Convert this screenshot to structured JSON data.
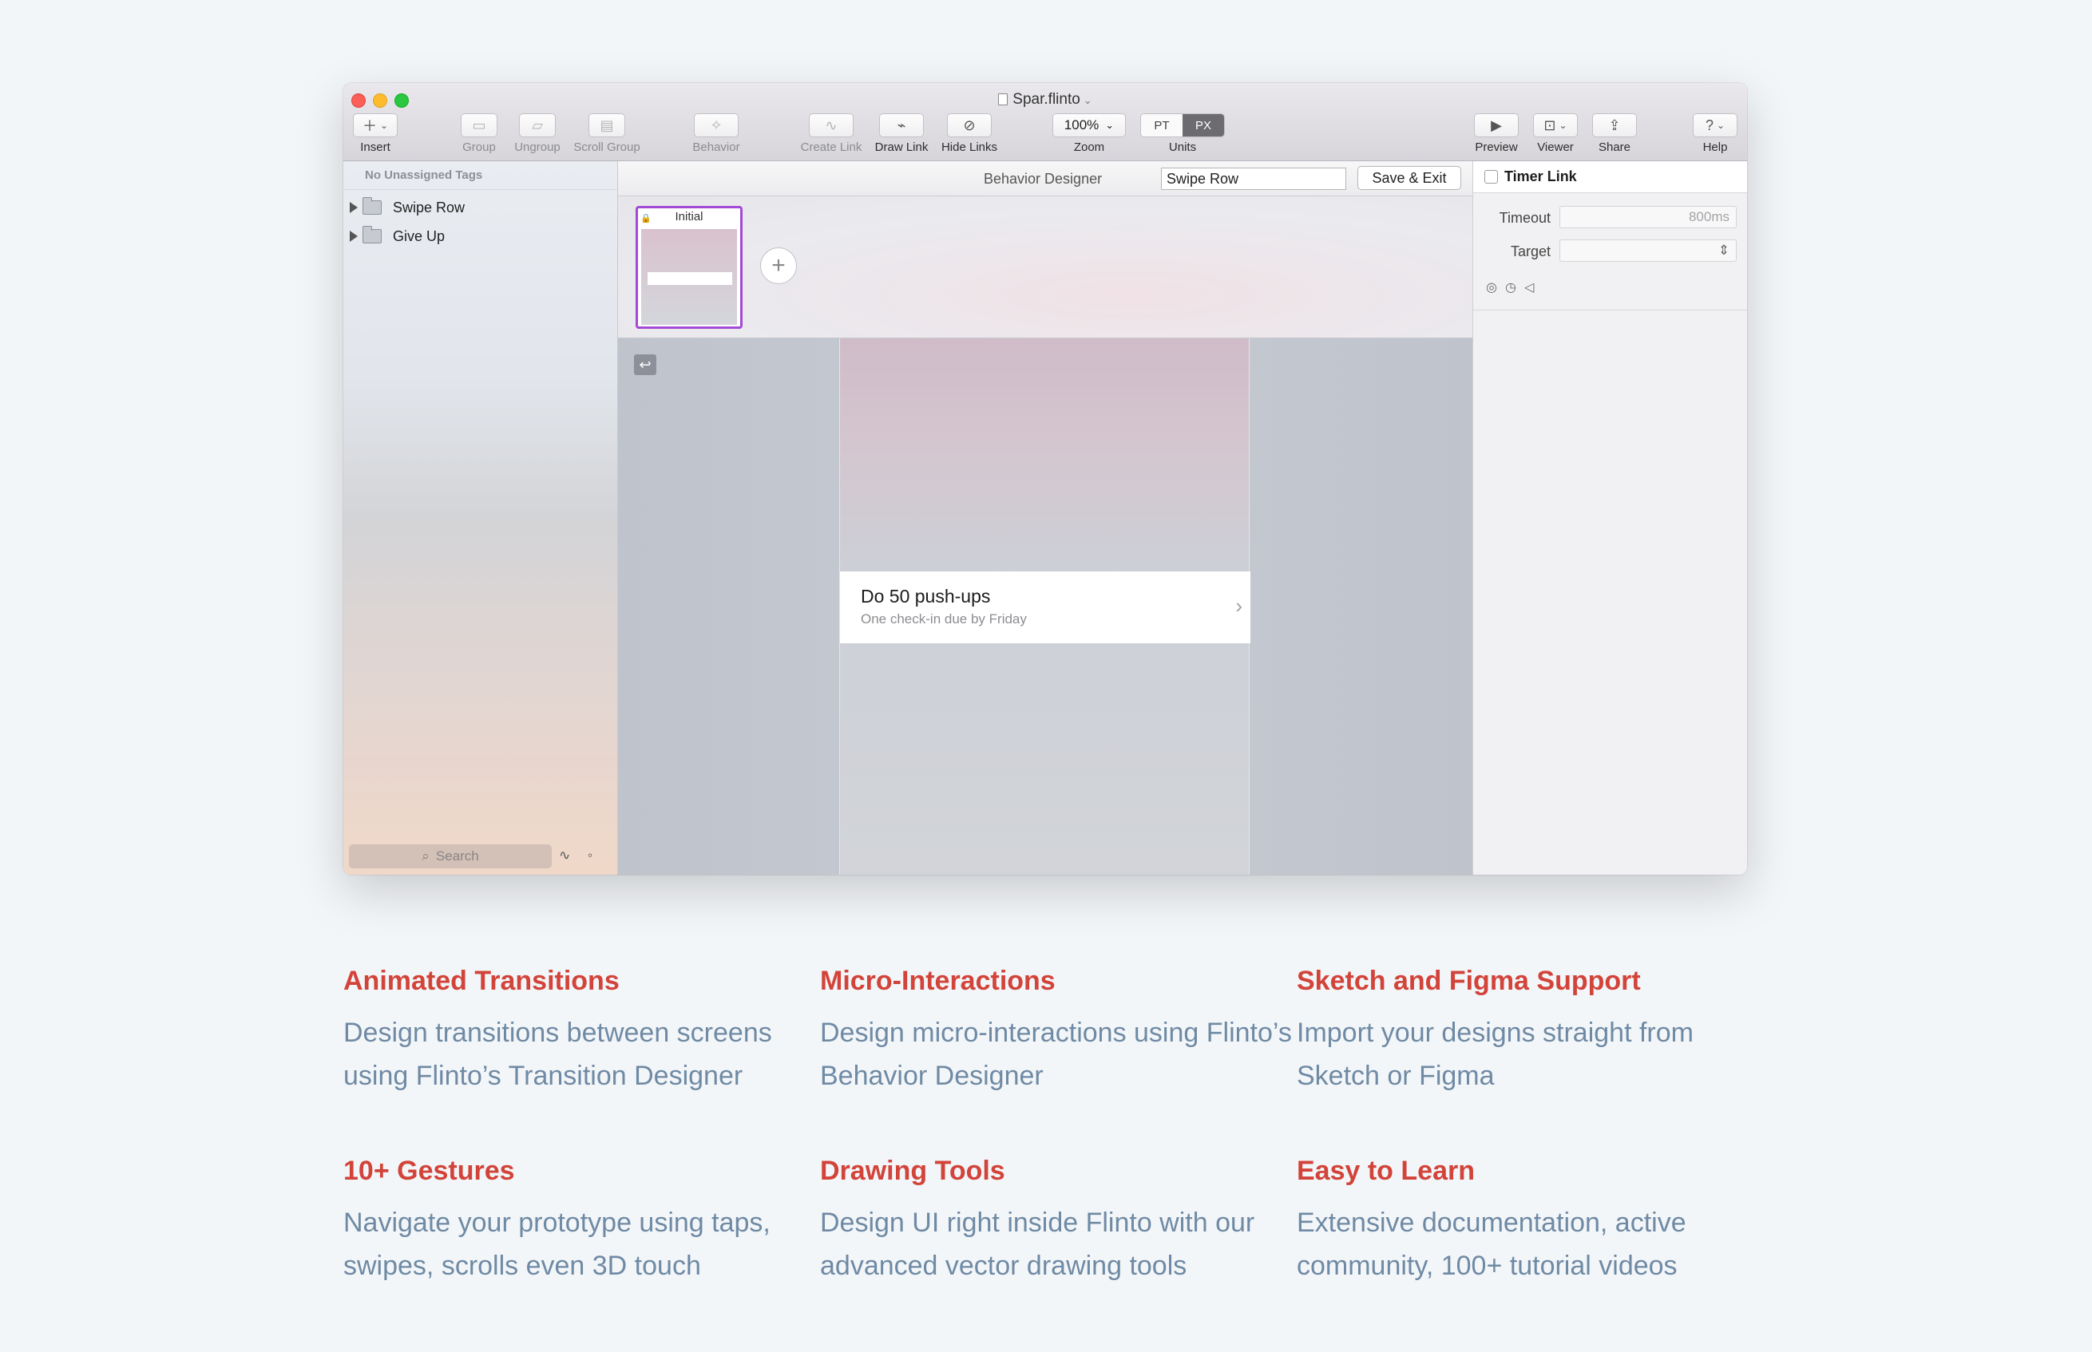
{
  "window": {
    "title": "Spar.flinto",
    "toolbar": {
      "insert": "Insert",
      "group": "Group",
      "ungroup": "Ungroup",
      "scroll_group": "Scroll Group",
      "behavior": "Behavior",
      "create_link": "Create Link",
      "draw_link": "Draw Link",
      "hide_links": "Hide Links",
      "zoom_value": "100%",
      "zoom": "Zoom",
      "unit_pt": "PT",
      "unit_px": "PX",
      "units": "Units",
      "preview": "Preview",
      "viewer": "Viewer",
      "share": "Share",
      "help": "Help"
    }
  },
  "sidebar": {
    "header": "No Unassigned Tags",
    "items": [
      {
        "label": "Swipe Row"
      },
      {
        "label": "Give Up"
      }
    ],
    "search_placeholder": "Search"
  },
  "behavior_designer": {
    "title": "Behavior Designer",
    "name_value": "Swipe Row",
    "save_exit": "Save & Exit",
    "state_label": "Initial"
  },
  "canvas": {
    "row_title": "Do 50 push-ups",
    "row_subtitle": "One check-in due by Friday"
  },
  "inspector": {
    "title": "Timer Link",
    "timeout_label": "Timeout",
    "timeout_value": "800ms",
    "target_label": "Target"
  },
  "features": [
    {
      "title": "Animated Transitions",
      "desc": "Design transitions between screens using Flinto’s Transition Designer"
    },
    {
      "title": "Micro-Interactions",
      "desc": "Design micro-interactions using Flinto’s Behavior Designer"
    },
    {
      "title": "Sketch and Figma Support",
      "desc": "Import your designs straight from Sketch or Figma"
    },
    {
      "title": "10+ Gestures",
      "desc": "Navigate your prototype using taps, swipes, scrolls even 3D touch"
    },
    {
      "title": "Drawing Tools",
      "desc": "Design UI right inside Flinto with our advanced vector drawing tools"
    },
    {
      "title": "Easy to Learn",
      "desc": "Extensive documentation, active community, 100+ tutorial videos"
    }
  ],
  "colors": {
    "feature_title": "#d2443a",
    "feature_text": "#6f8aa4",
    "state_highlight": "#a24ad6"
  }
}
